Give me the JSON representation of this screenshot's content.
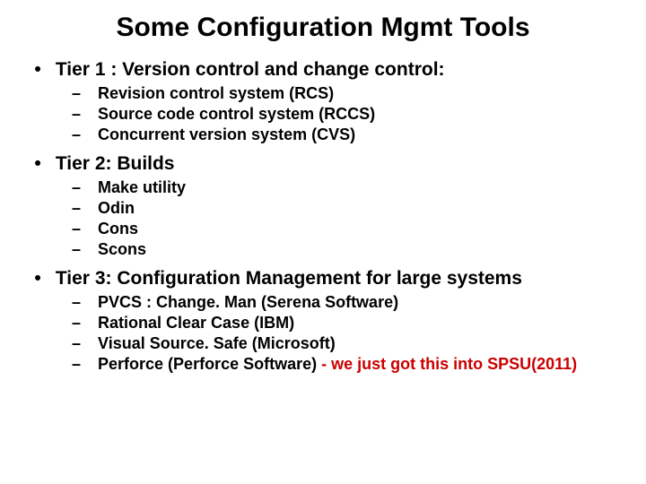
{
  "title": "Some Configuration Mgmt Tools",
  "tiers": [
    {
      "heading": "Tier 1 : Version control and change control:",
      "items": [
        "Revision control system (RCS)",
        "Source code control system (RCCS)",
        "Concurrent version system (CVS)"
      ]
    },
    {
      "heading": "Tier 2: Builds",
      "items": [
        "Make utility",
        "Odin",
        "Cons",
        "Scons"
      ]
    },
    {
      "heading": "Tier 3: Configuration Management for large systems",
      "items": [
        "PVCS : Change. Man  (Serena Software)",
        "Rational Clear Case (IBM)",
        "Visual Source. Safe (Microsoft)",
        "Perforce   (Perforce Software)  "
      ],
      "trailing_note": "- we just got this into SPSU(2011)"
    }
  ]
}
